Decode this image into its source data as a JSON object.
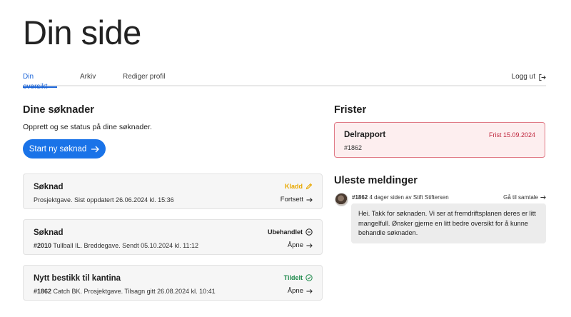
{
  "page": {
    "title": "Din side"
  },
  "tabs": [
    {
      "label": "Din oversikt",
      "active": true
    },
    {
      "label": "Arkiv",
      "active": false
    },
    {
      "label": "Rediger profil",
      "active": false
    }
  ],
  "logout": {
    "label": "Logg ut",
    "icon": "logout-icon"
  },
  "applications": {
    "heading": "Dine søknader",
    "description": "Opprett og se status på dine søknader.",
    "new_button": "Start ny søknad",
    "items": [
      {
        "title": "Søknad",
        "number": "",
        "detail": "Prosjektgave. Sist oppdatert 26.06.2024 kl. 15:36",
        "status": "Kladd",
        "status_color": "#e8a800",
        "status_icon": "pencil-icon",
        "action": "Fortsett"
      },
      {
        "title": "Søknad",
        "number": "#2010",
        "detail": " Tullball IL. Breddegave. Sendt 05.10.2024 kl. 11:12",
        "status": "Ubehandlet",
        "status_color": "#1d1d1d",
        "status_icon": "minus-circle-icon",
        "action": "Åpne"
      },
      {
        "title": "Nytt bestikk til kantina",
        "number": "#1862",
        "detail": " Catch BK. Prosjektgave. Tilsagn gitt 26.08.2024 kl. 10:41",
        "status": "Tildelt",
        "status_color": "#1f8a4c",
        "status_icon": "check-circle-icon",
        "action": "Åpne"
      }
    ]
  },
  "deadlines": {
    "heading": "Frister",
    "items": [
      {
        "title": "Delrapport",
        "date": "Frist 15.09.2024",
        "number": "#1862"
      }
    ]
  },
  "messages": {
    "heading": "Uleste meldinger",
    "items": [
      {
        "number": "#1862",
        "meta": " 4 dager siden av Stift Stiftersen",
        "link": "Gå til samtale",
        "text": "Hei. Takk for søknaden. Vi ser at fremdriftsplanen deres er litt mangelfull. Ønsker gjerne en litt bedre oversikt for å kunne behandle søknaden."
      }
    ]
  },
  "colors": {
    "accent": "#1a73e8",
    "deadline_border": "#e07a86",
    "deadline_bg": "#fdeeef",
    "deadline_text": "#c0283f"
  }
}
